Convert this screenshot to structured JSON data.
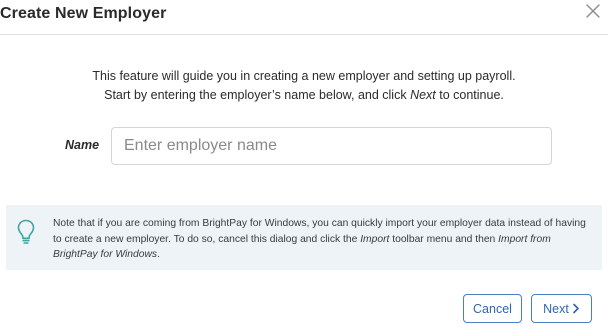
{
  "dialog": {
    "title": "Create New Employer",
    "close_icon": "close-icon"
  },
  "intro": {
    "line1": "This feature will guide you in creating a new employer and setting up payroll.",
    "line2_prefix": "Start by entering the employer’s name below, and click ",
    "line2_emphasis": "Next",
    "line2_suffix": " to continue."
  },
  "form": {
    "name_label": "Name",
    "name_placeholder": "Enter employer name",
    "name_value": ""
  },
  "note": {
    "icon": "lightbulb-icon",
    "part1": "Note that if you are coming from BrightPay for Windows, you can quickly import your employer data instead of having to create a new employer. To do so, cancel this dialog and click the ",
    "import_emphasis": "Import",
    "part2": " toolbar menu and then ",
    "import_from_emphasis": "Import from BrightPay for Windows",
    "part3": "."
  },
  "footer": {
    "cancel_label": "Cancel",
    "next_label": "Next",
    "next_icon": "chevron-right-icon"
  },
  "colors": {
    "accent": "#2f66b3",
    "note_background": "#eef3f8",
    "bulb": "#3aa6a0"
  }
}
